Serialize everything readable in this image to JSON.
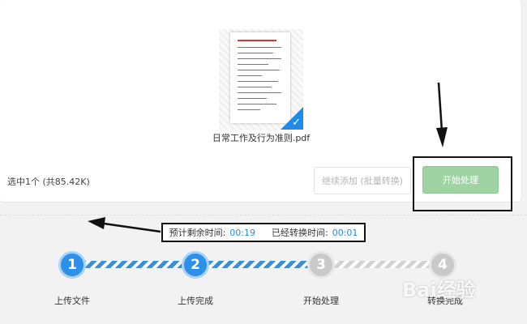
{
  "file": {
    "name": "日常工作及行为准则.pdf"
  },
  "toolbar": {
    "selection_info": "选中1个 (共85.42K)",
    "continue_label": "继续添加 (批量转换)",
    "start_label": "开始处理"
  },
  "timer": {
    "remaining_label": "预计剩余时间:",
    "remaining_value": "00:19",
    "elapsed_label": "已经转换时间:",
    "elapsed_value": "00:01"
  },
  "steps": [
    {
      "number": "1",
      "label": "上传文件",
      "status": "done"
    },
    {
      "number": "2",
      "label": "上传完成",
      "status": "done"
    },
    {
      "number": "3",
      "label": "开始处理",
      "status": "pending"
    },
    {
      "number": "4",
      "label": "转换完成",
      "status": "pending"
    }
  ],
  "watermark": {
    "text": "Bai经验"
  },
  "colors": {
    "accent": "#1e8be6",
    "start_button": "#9fd3a4",
    "pending": "#c9c9c9"
  }
}
